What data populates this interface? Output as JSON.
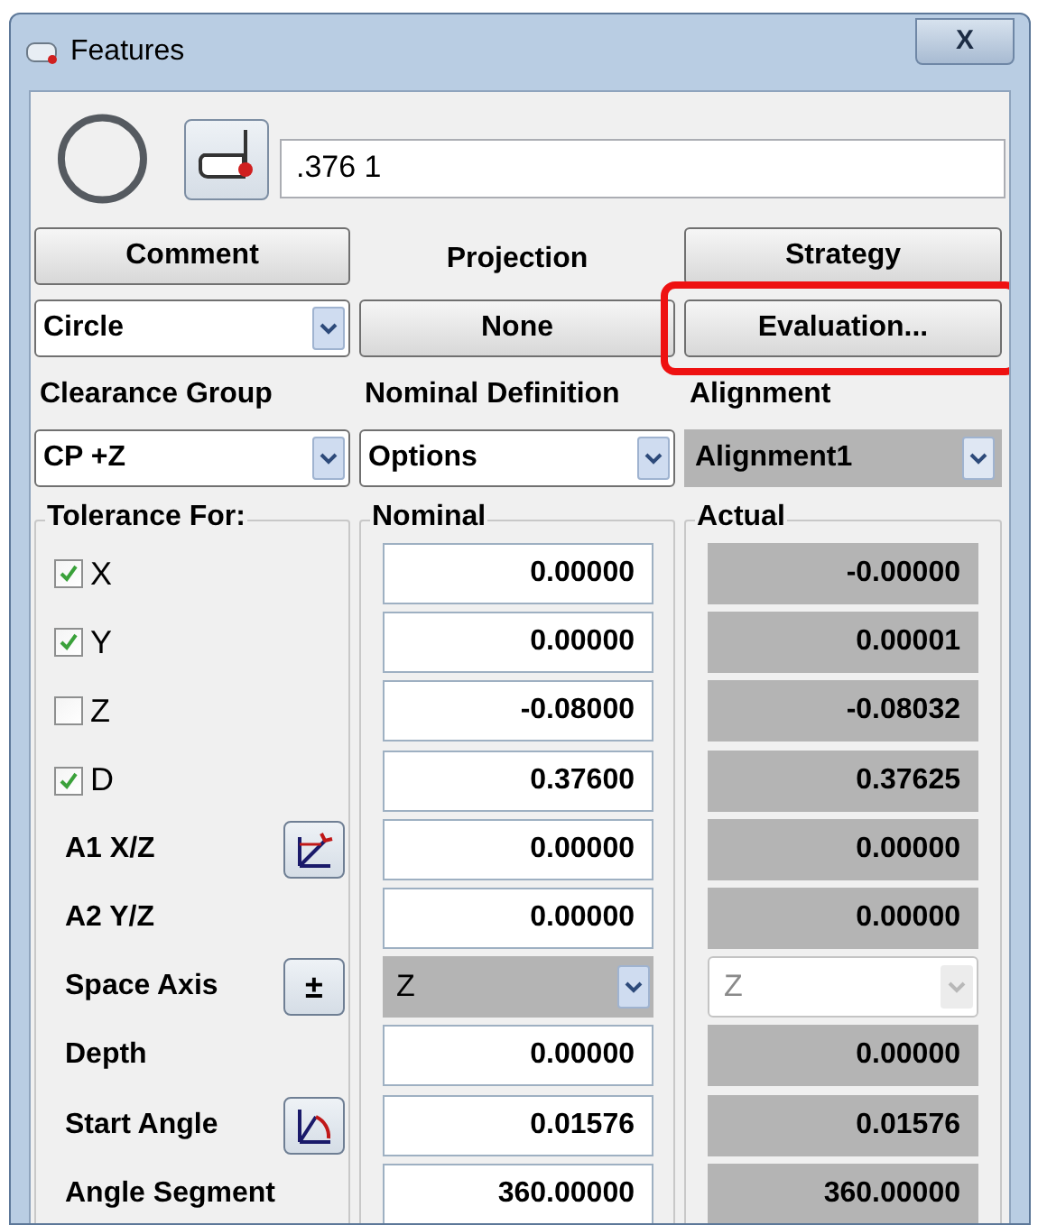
{
  "window": {
    "title": "Features",
    "close": "X"
  },
  "feature_id": ".376 1",
  "comment_button": "Comment",
  "projection_label": "Projection",
  "strategy_button": "Strategy",
  "feature_type": {
    "value": "Circle"
  },
  "projection_button": "None",
  "evaluation_button": {
    "label": "Evaluation...",
    "highlighted": true
  },
  "selectors": [
    {
      "label": "Clearance Group",
      "value": "CP +Z",
      "disabled": false
    },
    {
      "label": "Nominal Definition",
      "value": "Options",
      "disabled": false
    },
    {
      "label": "Alignment",
      "value": "Alignment1",
      "disabled": true
    }
  ],
  "groups": {
    "tolerance": "Tolerance For:",
    "nominal": "Nominal",
    "actual": "Actual"
  },
  "rows": [
    {
      "kind": "check",
      "label": "X",
      "checked": true,
      "nominal": "0.00000",
      "actual": "-0.00000"
    },
    {
      "kind": "check",
      "label": "Y",
      "checked": true,
      "nominal": "0.00000",
      "actual": "0.00001"
    },
    {
      "kind": "check",
      "label": "Z",
      "checked": false,
      "nominal": "-0.08000",
      "actual": "-0.08032"
    },
    {
      "kind": "check",
      "label": "D",
      "checked": true,
      "nominal": "0.37600",
      "actual": "0.37625"
    },
    {
      "kind": "label",
      "label": "A1 X/Z",
      "tool": {
        "kind": "axis-angle"
      },
      "nominal": "0.00000",
      "actual": "0.00000"
    },
    {
      "kind": "label",
      "label": "A2 Y/Z",
      "nominal": "0.00000",
      "actual": "0.00000"
    },
    {
      "kind": "dropdown",
      "label": "Space Axis",
      "tool": {
        "kind": "text",
        "text": "±"
      },
      "nominal": "Z",
      "actual": "Z"
    },
    {
      "kind": "label",
      "label": "Depth",
      "nominal": "0.00000",
      "actual": "0.00000"
    },
    {
      "kind": "label",
      "label": "Start Angle",
      "tool": {
        "kind": "start-angle"
      },
      "nominal": "0.01576",
      "actual": "0.01576"
    },
    {
      "kind": "label",
      "label": "Angle Segment",
      "nominal": "360.00000",
      "actual": "360.00000"
    }
  ]
}
